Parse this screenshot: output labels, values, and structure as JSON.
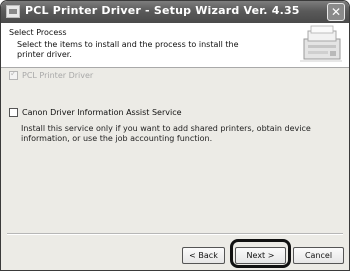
{
  "window": {
    "title": "PCL Printer Driver - Setup Wizard Ver. 4.35",
    "close_glyph": "✕"
  },
  "header": {
    "title": "Select Process",
    "description": "Select the items to install and the process to install the printer driver."
  },
  "options": [
    {
      "label": "PCL Printer Driver",
      "checked": true,
      "enabled": false
    },
    {
      "label": "Canon Driver Information Assist Service",
      "checked": false,
      "enabled": true
    }
  ],
  "service_description": "Install this service only if you want to add shared printers, obtain device information, or use the job accounting function.",
  "buttons": {
    "back": "< Back",
    "next": "Next >",
    "cancel": "Cancel"
  }
}
